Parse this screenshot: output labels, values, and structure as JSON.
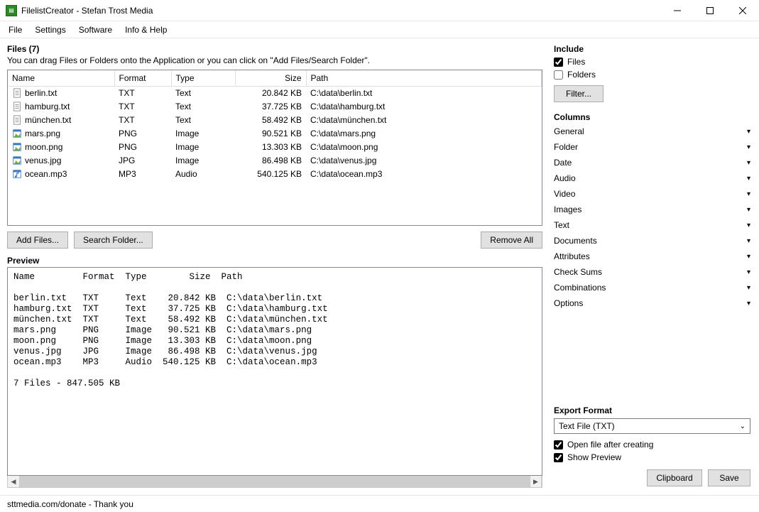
{
  "window": {
    "title": "FilelistCreator - Stefan Trost Media"
  },
  "menu": {
    "file": "File",
    "settings": "Settings",
    "software": "Software",
    "info": "Info & Help"
  },
  "files_section": {
    "heading": "Files (7)",
    "hint": "You can drag Files or Folders onto the Application or you can click on \"Add Files/Search Folder\".",
    "columns": {
      "name": "Name",
      "format": "Format",
      "type": "Type",
      "size": "Size",
      "path": "Path"
    },
    "rows": [
      {
        "icon": "txt",
        "name": "berlin.txt",
        "format": "TXT",
        "type": "Text",
        "size": "20.842 KB",
        "path": "C:\\data\\berlin.txt"
      },
      {
        "icon": "txt",
        "name": "hamburg.txt",
        "format": "TXT",
        "type": "Text",
        "size": "37.725 KB",
        "path": "C:\\data\\hamburg.txt"
      },
      {
        "icon": "txt",
        "name": "münchen.txt",
        "format": "TXT",
        "type": "Text",
        "size": "58.492 KB",
        "path": "C:\\data\\münchen.txt"
      },
      {
        "icon": "img",
        "name": "mars.png",
        "format": "PNG",
        "type": "Image",
        "size": "90.521 KB",
        "path": "C:\\data\\mars.png"
      },
      {
        "icon": "img",
        "name": "moon.png",
        "format": "PNG",
        "type": "Image",
        "size": "13.303 KB",
        "path": "C:\\data\\moon.png"
      },
      {
        "icon": "img",
        "name": "venus.jpg",
        "format": "JPG",
        "type": "Image",
        "size": "86.498 KB",
        "path": "C:\\data\\venus.jpg"
      },
      {
        "icon": "audio",
        "name": "ocean.mp3",
        "format": "MP3",
        "type": "Audio",
        "size": "540.125 KB",
        "path": "C:\\data\\ocean.mp3"
      }
    ],
    "buttons": {
      "add_files": "Add Files...",
      "search_folder": "Search Folder...",
      "remove_all": "Remove All"
    }
  },
  "preview_section": {
    "heading": "Preview",
    "text": "Name         Format  Type        Size  Path\n\nberlin.txt   TXT     Text    20.842 KB  C:\\data\\berlin.txt\nhamburg.txt  TXT     Text    37.725 KB  C:\\data\\hamburg.txt\nmünchen.txt  TXT     Text    58.492 KB  C:\\data\\münchen.txt\nmars.png     PNG     Image   90.521 KB  C:\\data\\mars.png\nmoon.png     PNG     Image   13.303 KB  C:\\data\\moon.png\nvenus.jpg    JPG     Image   86.498 KB  C:\\data\\venus.jpg\nocean.mp3    MP3     Audio  540.125 KB  C:\\data\\ocean.mp3\n\n7 Files - 847.505 KB"
  },
  "include_section": {
    "heading": "Include",
    "files_label": "Files",
    "files_checked": true,
    "folders_label": "Folders",
    "folders_checked": false,
    "filter_btn": "Filter..."
  },
  "columns_section": {
    "heading": "Columns",
    "items": [
      "General",
      "Folder",
      "Date",
      "Audio",
      "Video",
      "Images",
      "Text",
      "Documents",
      "Attributes",
      "Check Sums",
      "Combinations",
      "Options"
    ]
  },
  "export_section": {
    "heading": "Export Format",
    "selected": "Text File (TXT)",
    "open_after_label": "Open file after creating",
    "open_after_checked": true,
    "show_preview_label": "Show Preview",
    "show_preview_checked": true,
    "clipboard_btn": "Clipboard",
    "save_btn": "Save"
  },
  "statusbar": {
    "text": "sttmedia.com/donate - Thank you"
  }
}
